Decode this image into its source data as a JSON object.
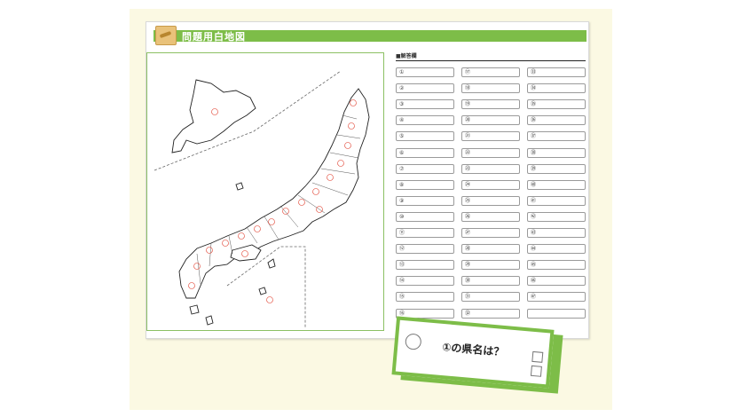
{
  "sheet": {
    "title": "問題用白地図"
  },
  "answers": {
    "header": "■解答欄",
    "columns": [
      [
        "①",
        "②",
        "③",
        "④",
        "⑤",
        "⑥",
        "⑦",
        "⑧",
        "⑨",
        "⑩",
        "⑪",
        "⑫",
        "⑬",
        "⑭",
        "⑮",
        "⑯"
      ],
      [
        "⑰",
        "⑱",
        "⑲",
        "⑳",
        "㉑",
        "㉒",
        "㉓",
        "㉔",
        "㉕",
        "㉖",
        "㉗",
        "㉘",
        "㉙",
        "㉚",
        "㉛",
        "㉜"
      ],
      [
        "㉝",
        "㉞",
        "㉟",
        "㊱",
        "㊲",
        "㊳",
        "㊴",
        "㊵",
        "㊶",
        "㊷",
        "㊸",
        "㊹",
        "㊺",
        "㊻",
        "㊼",
        ""
      ]
    ]
  },
  "card": {
    "question": "①の県名は？"
  },
  "colors": {
    "accent": "#7dbd48",
    "background": "#fbf9e3",
    "number_red": "#e03b2a"
  },
  "icons": [
    "scroll-icon",
    "circle-marker-icon",
    "checkbox-icon"
  ]
}
